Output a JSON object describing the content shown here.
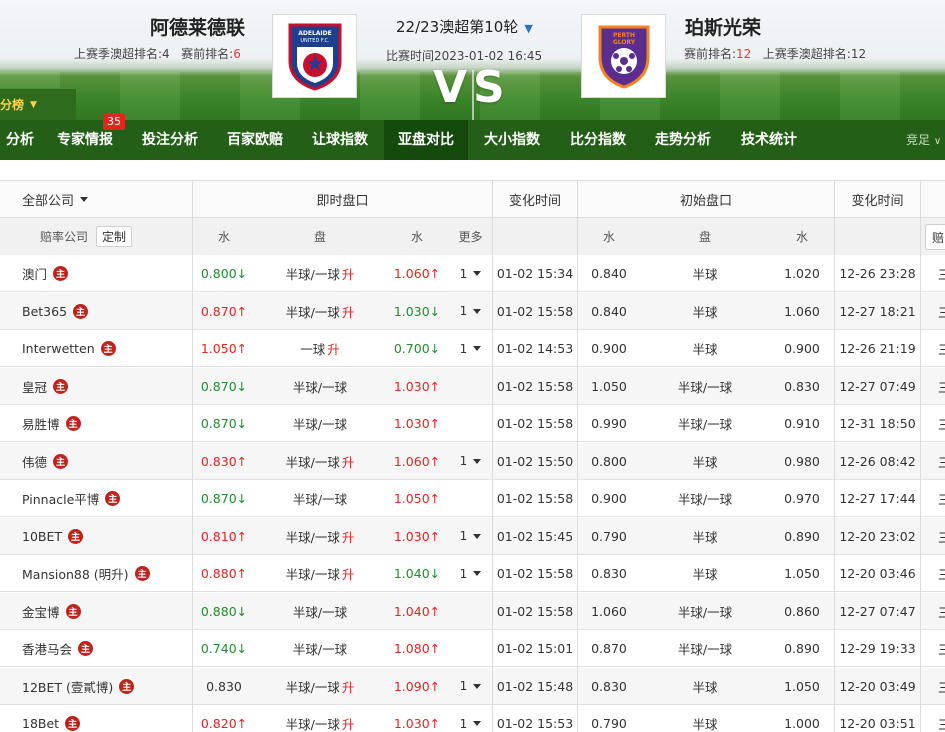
{
  "match": {
    "home_team": "阿德莱德联",
    "home_last_season_label": "上赛季澳超排名:",
    "home_last_season_rank": "4",
    "home_current_label": "赛前排名:",
    "home_current_rank": "6",
    "away_team": "珀斯光荣",
    "away_current_label": "赛前排名:",
    "away_current_rank": "12",
    "away_last_season_text": "上赛季澳超排名:12",
    "round": "22/23澳超第10轮",
    "time_label": "比赛时间2023-01-02 16:45",
    "vs": "VS",
    "home_logo_text": "ADELAIDE UNITED F.C.",
    "away_logo_text": "PERTH GLORY"
  },
  "score_dropdown": "积分榜",
  "nav": {
    "items": [
      "分析",
      "专家情报",
      "投注分析",
      "百家欧赔",
      "让球指数",
      "亚盘对比",
      "大小指数",
      "比分指数",
      "走势分析",
      "技术统计"
    ],
    "active_index": 5,
    "badge": "35",
    "more": "竞足"
  },
  "table": {
    "company_filter": "全部公司",
    "live_header": "即时盘口",
    "change_time_header": "变化时间",
    "initial_header": "初始盘口",
    "change_time_header2": "变化时间",
    "sub_company": "赔率公司",
    "custom": "定制",
    "sub_water": "水",
    "sub_handicap": "盘",
    "sub_water2": "水",
    "sub_more": "更多",
    "sub_i_water": "水",
    "sub_i_handicap": "盘",
    "sub_i_water2": "水",
    "edge_label": "赔",
    "edge_cell": "三",
    "zhu_mark": "主",
    "up_mark": "升",
    "rows": [
      {
        "company": "澳门",
        "w1": "0.800",
        "w1d": "down",
        "h": "半球/一球",
        "hup": true,
        "w2": "1.060",
        "w2d": "up",
        "more": "1",
        "t": "01-02 15:34",
        "iw1": "0.840",
        "ih": "半球",
        "iw2": "1.020",
        "it": "12-26 23:28"
      },
      {
        "company": "Bet365",
        "w1": "0.870",
        "w1d": "up",
        "h": "半球/一球",
        "hup": true,
        "w2": "1.030",
        "w2d": "down",
        "more": "1",
        "t": "01-02 15:58",
        "iw1": "0.840",
        "ih": "半球",
        "iw2": "1.060",
        "it": "12-27 18:21"
      },
      {
        "company": "Interwetten",
        "w1": "1.050",
        "w1d": "up",
        "h": "一球",
        "hup": true,
        "w2": "0.700",
        "w2d": "down",
        "more": "1",
        "t": "01-02 14:53",
        "iw1": "0.900",
        "ih": "半球",
        "iw2": "0.900",
        "it": "12-26 21:19"
      },
      {
        "company": "皇冠",
        "w1": "0.870",
        "w1d": "down",
        "h": "半球/一球",
        "hup": false,
        "w2": "1.030",
        "w2d": "up",
        "more": "",
        "t": "01-02 15:58",
        "iw1": "1.050",
        "ih": "半球/一球",
        "iw2": "0.830",
        "it": "12-27 07:49"
      },
      {
        "company": "易胜博",
        "w1": "0.870",
        "w1d": "down",
        "h": "半球/一球",
        "hup": false,
        "w2": "1.030",
        "w2d": "up",
        "more": "",
        "t": "01-02 15:58",
        "iw1": "0.990",
        "ih": "半球/一球",
        "iw2": "0.910",
        "it": "12-31 18:50"
      },
      {
        "company": "伟德",
        "w1": "0.830",
        "w1d": "up",
        "h": "半球/一球",
        "hup": true,
        "w2": "1.060",
        "w2d": "up",
        "more": "1",
        "t": "01-02 15:50",
        "iw1": "0.800",
        "ih": "半球",
        "iw2": "0.980",
        "it": "12-26 08:42"
      },
      {
        "company": "Pinnacle平博",
        "w1": "0.870",
        "w1d": "down",
        "h": "半球/一球",
        "hup": false,
        "w2": "1.050",
        "w2d": "up",
        "more": "",
        "t": "01-02 15:58",
        "iw1": "0.900",
        "ih": "半球/一球",
        "iw2": "0.970",
        "it": "12-27 17:44"
      },
      {
        "company": "10BET",
        "w1": "0.810",
        "w1d": "up",
        "h": "半球/一球",
        "hup": true,
        "w2": "1.030",
        "w2d": "up",
        "more": "1",
        "t": "01-02 15:45",
        "iw1": "0.790",
        "ih": "半球",
        "iw2": "0.890",
        "it": "12-20 23:02"
      },
      {
        "company": "Mansion88 (明升)",
        "w1": "0.880",
        "w1d": "up",
        "h": "半球/一球",
        "hup": true,
        "w2": "1.040",
        "w2d": "down",
        "more": "1",
        "t": "01-02 15:58",
        "iw1": "0.830",
        "ih": "半球",
        "iw2": "1.050",
        "it": "12-20 03:46"
      },
      {
        "company": "金宝博",
        "w1": "0.880",
        "w1d": "down",
        "h": "半球/一球",
        "hup": false,
        "w2": "1.040",
        "w2d": "up",
        "more": "",
        "t": "01-02 15:58",
        "iw1": "1.060",
        "ih": "半球/一球",
        "iw2": "0.860",
        "it": "12-27 07:47"
      },
      {
        "company": "香港马会",
        "w1": "0.740",
        "w1d": "down",
        "h": "半球/一球",
        "hup": false,
        "w2": "1.080",
        "w2d": "up",
        "more": "",
        "t": "01-02 15:01",
        "iw1": "0.870",
        "ih": "半球/一球",
        "iw2": "0.890",
        "it": "12-29 19:33"
      },
      {
        "company": "12BET (壹貳博)",
        "w1": "0.830",
        "w1d": "none",
        "h": "半球/一球",
        "hup": true,
        "w2": "1.090",
        "w2d": "up",
        "more": "1",
        "t": "01-02 15:48",
        "iw1": "0.830",
        "ih": "半球",
        "iw2": "1.050",
        "it": "12-20 03:49"
      },
      {
        "company": "18Bet",
        "w1": "0.820",
        "w1d": "up",
        "h": "半球/一球",
        "hup": true,
        "w2": "1.030",
        "w2d": "up",
        "more": "1",
        "t": "01-02 15:53",
        "iw1": "0.790",
        "ih": "半球",
        "iw2": "1.000",
        "it": "12-20 03:51"
      }
    ]
  },
  "colors": {
    "up": "#e0261d",
    "down": "#1f8f2a",
    "nav_bg": "#235f16",
    "nav_active": "#154a0d"
  }
}
